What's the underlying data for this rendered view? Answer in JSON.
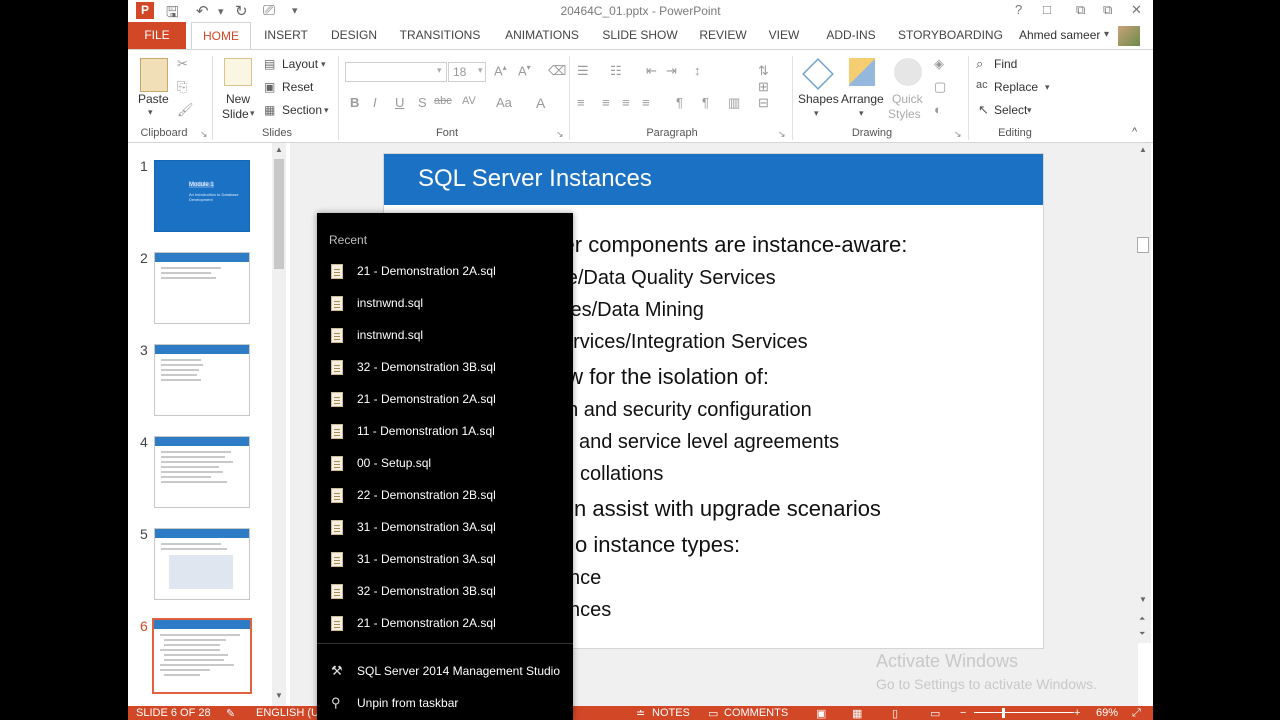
{
  "window": {
    "title": "20464C_01.pptx - PowerPoint",
    "app_logo": "P",
    "controls": [
      "?",
      "□",
      "⧉",
      "✕"
    ]
  },
  "tabs": {
    "file": "FILE",
    "items": [
      "HOME",
      "INSERT",
      "DESIGN",
      "TRANSITIONS",
      "ANIMATIONS",
      "SLIDE SHOW",
      "REVIEW",
      "VIEW",
      "ADD-INS",
      "STORYBOARDING"
    ],
    "user": "Ahmed sameer"
  },
  "ribbon": {
    "clipboard": {
      "paste": "Paste",
      "label": "Clipboard"
    },
    "slides": {
      "new_slide_1": "New",
      "new_slide_2": "Slide",
      "layout": "Layout",
      "reset": "Reset",
      "section": "Section",
      "label": "Slides"
    },
    "font": {
      "size": "18",
      "label": "Font",
      "bold": "B",
      "italic": "I",
      "underline": "U",
      "shadow": "S",
      "strike": "abc",
      "spacing": "AV",
      "case": "Aa",
      "color": "A"
    },
    "paragraph": {
      "label": "Paragraph"
    },
    "drawing": {
      "shapes": "Shapes",
      "arrange": "Arrange",
      "quick_styles_1": "Quick",
      "quick_styles_2": "Styles",
      "label": "Drawing"
    },
    "editing": {
      "find": "Find",
      "replace": "Replace",
      "select": "Select",
      "label": "Editing"
    }
  },
  "thumbnails": {
    "numbers": [
      "1",
      "2",
      "3",
      "4",
      "5",
      "6"
    ],
    "selected": "6",
    "slide1_title": "Module 1",
    "slide1_sub": "An Introduction to Database Development"
  },
  "slide": {
    "title": "SQL Server Instances",
    "lines": [
      "erver components are instance-aware:",
      "gine/Data Quality Services",
      "vices/Data Mining",
      "ervices/Integration Services",
      "ow for the isolation of:",
      "on and security configuration",
      "and service level agreements",
      "collations",
      "n assist with upgrade scenarios",
      "o instance types:",
      "nce",
      "nces"
    ]
  },
  "jumplist": {
    "header": "Recent",
    "items": [
      "21 - Demonstration 2A.sql",
      "instnwnd.sql",
      "instnwnd.sql",
      "32 - Demonstration 3B.sql",
      "21 - Demonstration 2A.sql",
      "11 - Demonstration 1A.sql",
      "00 - Setup.sql",
      "22 - Demonstration 2B.sql",
      "31 - Demonstration 3A.sql",
      "31 - Demonstration 3A.sql",
      "32 - Demonstration 3B.sql",
      "21 - Demonstration 2A.sql"
    ],
    "tasks": [
      "SQL Server 2014 Management Studio",
      "Unpin from taskbar"
    ]
  },
  "statusbar": {
    "slide_info": "SLIDE 6 OF 28",
    "language": "ENGLISH (U",
    "notes": "NOTES",
    "comments": "COMMENTS",
    "zoom": "69%"
  },
  "watermark": {
    "line1": "Activate Windows",
    "line2": "Go to Settings to activate Windows."
  },
  "colors": {
    "accent": "#d24726",
    "slide_blue": "#1b72c4"
  }
}
